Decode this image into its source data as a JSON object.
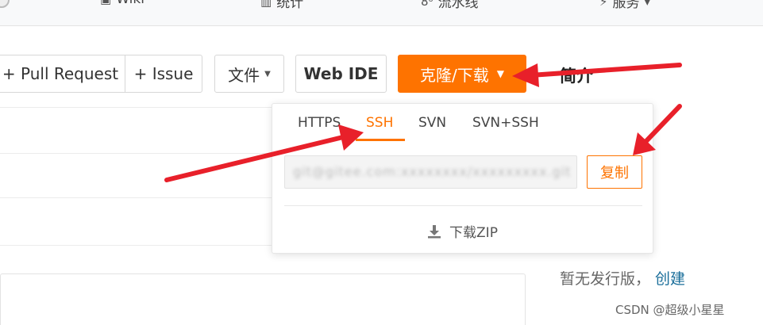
{
  "nav": {
    "items": [
      {
        "icon": "wiki-icon",
        "label": "Wiki"
      },
      {
        "icon": "stats-icon",
        "label": "统计"
      },
      {
        "icon": "pipeline-icon",
        "label": "流水线"
      },
      {
        "icon": "service-icon",
        "label": "服务"
      }
    ]
  },
  "toolbar": {
    "pull_request_label": "+ Pull Request",
    "issue_label": "+ Issue",
    "file_label": "文件",
    "webide_label": "Web IDE",
    "clone_label": "克隆/下载"
  },
  "sidebar": {
    "intro_title": "简介",
    "release_text": "暂无发行版，",
    "release_create": "创建"
  },
  "dropdown": {
    "tabs": [
      {
        "label": "HTTPS"
      },
      {
        "label": "SSH",
        "active": true
      },
      {
        "label": "SVN"
      },
      {
        "label": "SVN+SSH"
      }
    ],
    "url_value": "git@gitee.com:xxxxxxxx/xxxxxxxxx.git",
    "copy_label": "复制",
    "zip_label": "下载ZIP"
  },
  "watermark": "CSDN @超级小星星",
  "colors": {
    "accent": "#fe7300",
    "annotation_arrow": "#e8202a",
    "link": "#1a6e9a"
  }
}
